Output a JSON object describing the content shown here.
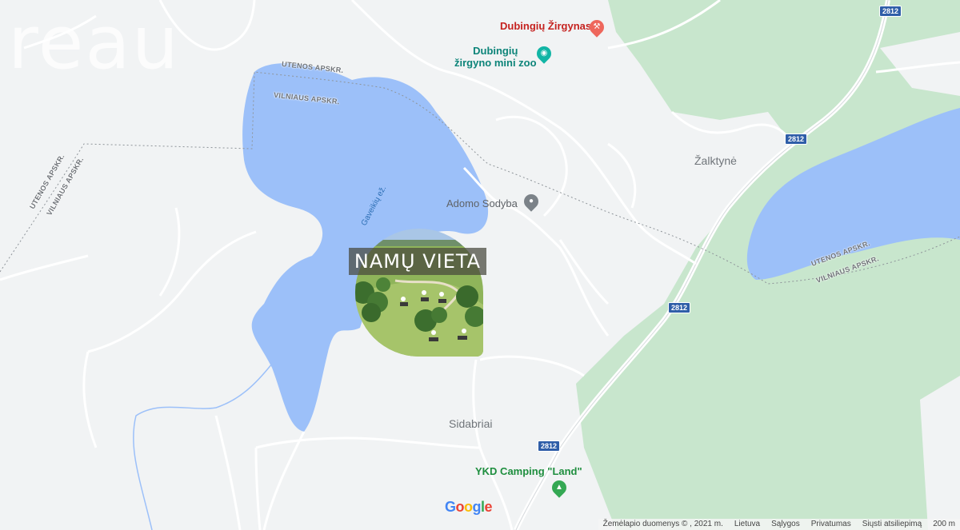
{
  "watermark": "reau",
  "pois": {
    "zirgynas": "Dubingių Žirgynas",
    "zoo_line1": "Dubingių",
    "zoo_line2": "žirgyno mini zoo",
    "sodyba": "Adomo Sodyba",
    "camping": "YKD Camping \"Land\""
  },
  "places": {
    "zalktyne": "Žalktynė",
    "sidabriai": "Sidabriai"
  },
  "water": {
    "lake_label": "Gaveikių ež."
  },
  "admin_labels": {
    "utenos": "UTENOS APSKR.",
    "vilniaus": "VILNIAUS APSKR."
  },
  "road": {
    "number": "2812"
  },
  "badge": {
    "title": "NAMŲ VIETA"
  },
  "logo": {
    "g1": "G",
    "o1": "o",
    "o2": "o",
    "g2": "g",
    "l": "l",
    "e": "e"
  },
  "attribution": {
    "data": "Žemėlapio duomenys © , 2021 m.",
    "country": "Lietuva",
    "terms": "Sąlygos",
    "privacy": "Privatumas",
    "feedback": "Siųsti atsiliepimą",
    "scale": "200 m"
  },
  "colors": {
    "background": "#f1f3f4",
    "water": "#9cc0f9",
    "forest": "#c8e6cd",
    "road_shield": "#2f5ea8"
  }
}
